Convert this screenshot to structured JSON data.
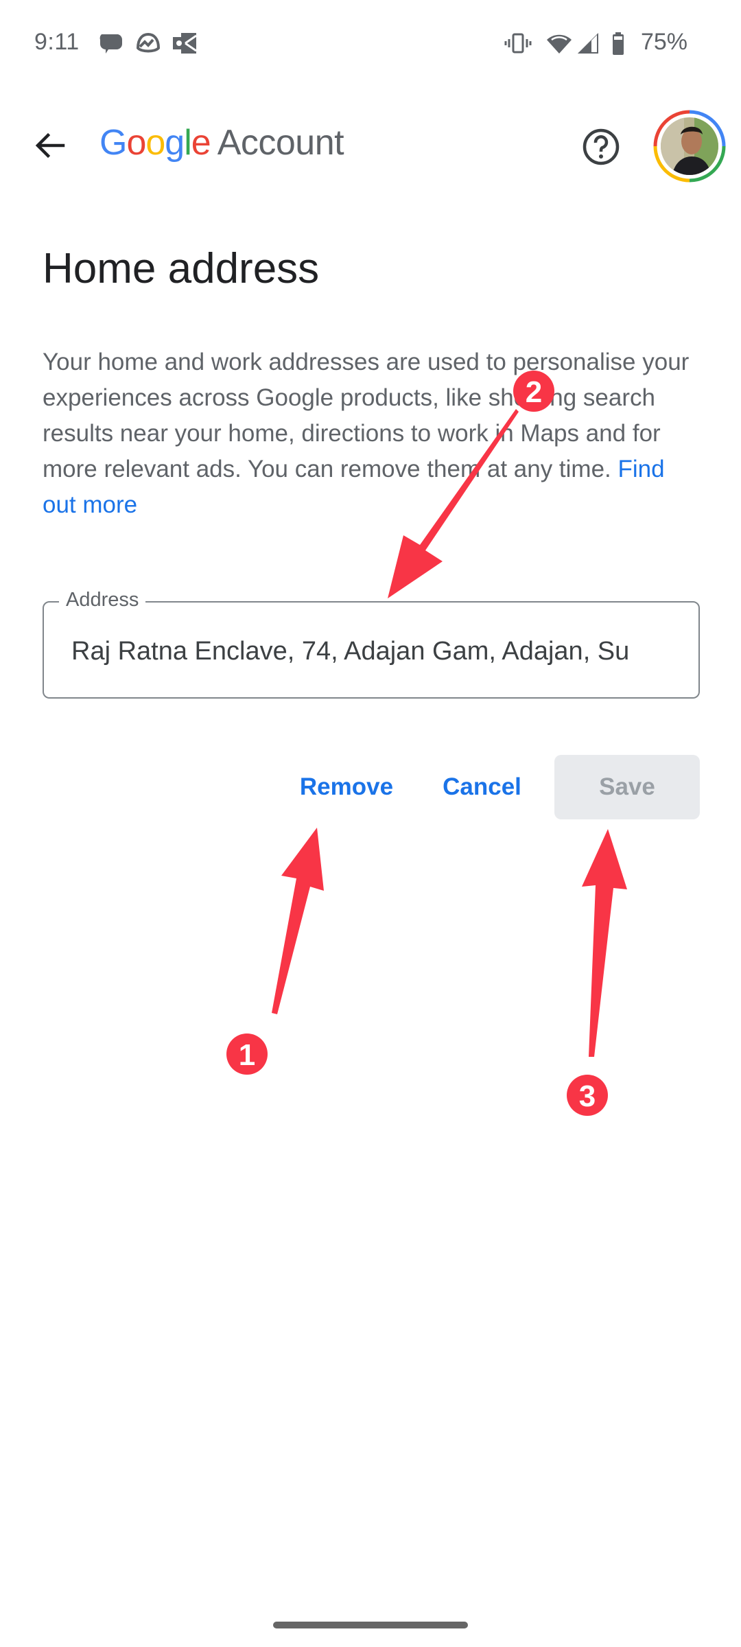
{
  "status_bar": {
    "time": "9:11",
    "left_icons": [
      "chat-bubble-icon",
      "basecamp-icon",
      "outlook-icon"
    ],
    "right_icons": [
      "vibrate-icon",
      "wifi-icon",
      "cell-signal-icon",
      "battery-icon"
    ],
    "battery_percent": "75%"
  },
  "app_bar": {
    "back_icon": "arrow-back-icon",
    "logo_letters": [
      "G",
      "o",
      "o",
      "g",
      "l",
      "e"
    ],
    "logo_suffix": "Account",
    "help_icon": "help-circle-icon",
    "avatar_alt": "Profile photo"
  },
  "page": {
    "title": "Home address",
    "description": "Your home and work addresses are used to personalise your experiences across Google products, like showing search results near your home, directions to work in Maps and for more relevant ads. You can remove them at any time.",
    "learn_more_link": "Find out more"
  },
  "address_field": {
    "label": "Address",
    "value": "Raj Ratna Enclave, 74, Adajan Gam, Adajan, Su"
  },
  "actions": {
    "remove_label": "Remove",
    "cancel_label": "Cancel",
    "save_label": "Save",
    "save_enabled": false
  },
  "annotations": {
    "color": "#f83546",
    "markers": [
      "1",
      "2",
      "3"
    ]
  },
  "colors": {
    "link": "#1a73e8",
    "text_primary": "#202124",
    "text_secondary": "#5f6368",
    "disabled_bg": "#e8eaed"
  }
}
